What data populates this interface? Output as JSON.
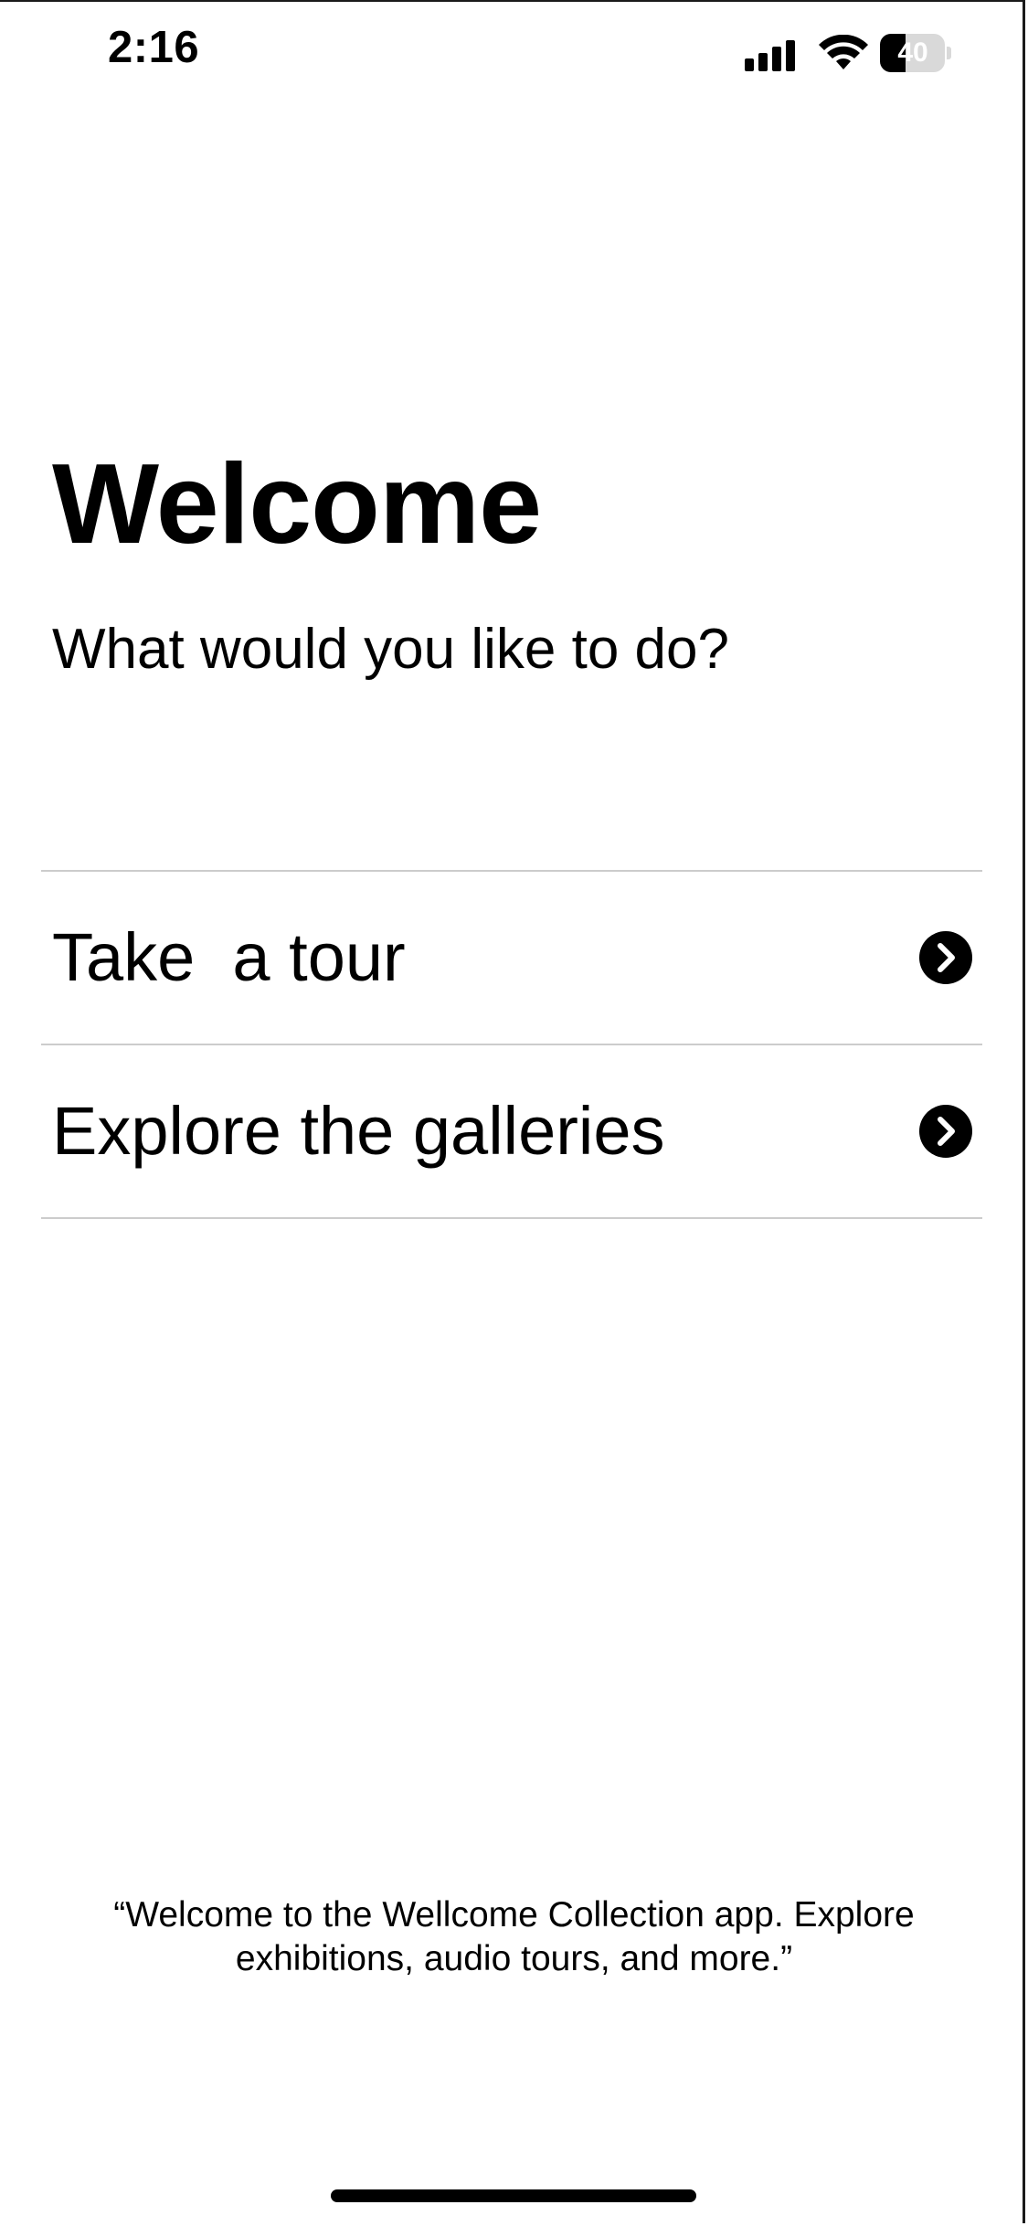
{
  "status_bar": {
    "time": "2:16",
    "battery_level": "40",
    "signal_icon": "cellular-signal-icon",
    "wifi_icon": "wifi-icon",
    "battery_icon": "battery-icon"
  },
  "header": {
    "title": "Welcome",
    "subtitle": "What would you like to do?"
  },
  "menu": {
    "items": [
      {
        "label": "Take  a tour",
        "icon": "chevron-right-circle-icon"
      },
      {
        "label": "Explore the galleries",
        "icon": "chevron-right-circle-icon"
      }
    ]
  },
  "footer": {
    "quote": "“Welcome to the Wellcome Collection app. Explore exhibitions, audio tours, and more.”"
  },
  "colors": {
    "text": "#000000",
    "background": "#ffffff",
    "divider": "#cccccc"
  }
}
